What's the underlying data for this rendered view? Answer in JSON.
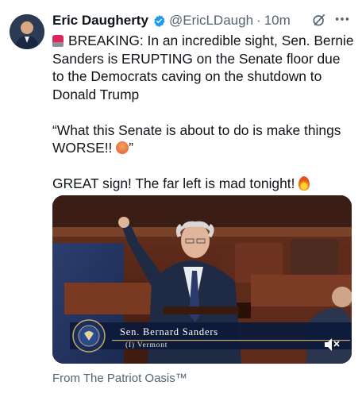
{
  "author": {
    "name": "Eric Daugherty",
    "handle": "@EricLDaugh",
    "separator": "·",
    "time": "10m"
  },
  "tweet": {
    "line1": "BREAKING: In an incredible sight, Sen. Bernie Sanders is ERUPTING on the Senate floor due to the Democrats caving on the shutdown to Donald Trump",
    "line2": "“What this Senate is about to do is make things WORSE!! ",
    "line2_end": "”",
    "line3": "GREAT sign! The far left is mad tonight! "
  },
  "media": {
    "chyron_name": "Sen. Bernard Sanders",
    "chyron_sub": "(I) Vermont"
  },
  "source": "From The Patriot Oasis™",
  "icons": {
    "verified": "verified-badge-icon",
    "grok": "grok-icon",
    "more": "more-options-icon",
    "mute": "volume-muted-icon"
  },
  "colors": {
    "verified": "#1d9bf0",
    "secondary_text": "#536471"
  }
}
